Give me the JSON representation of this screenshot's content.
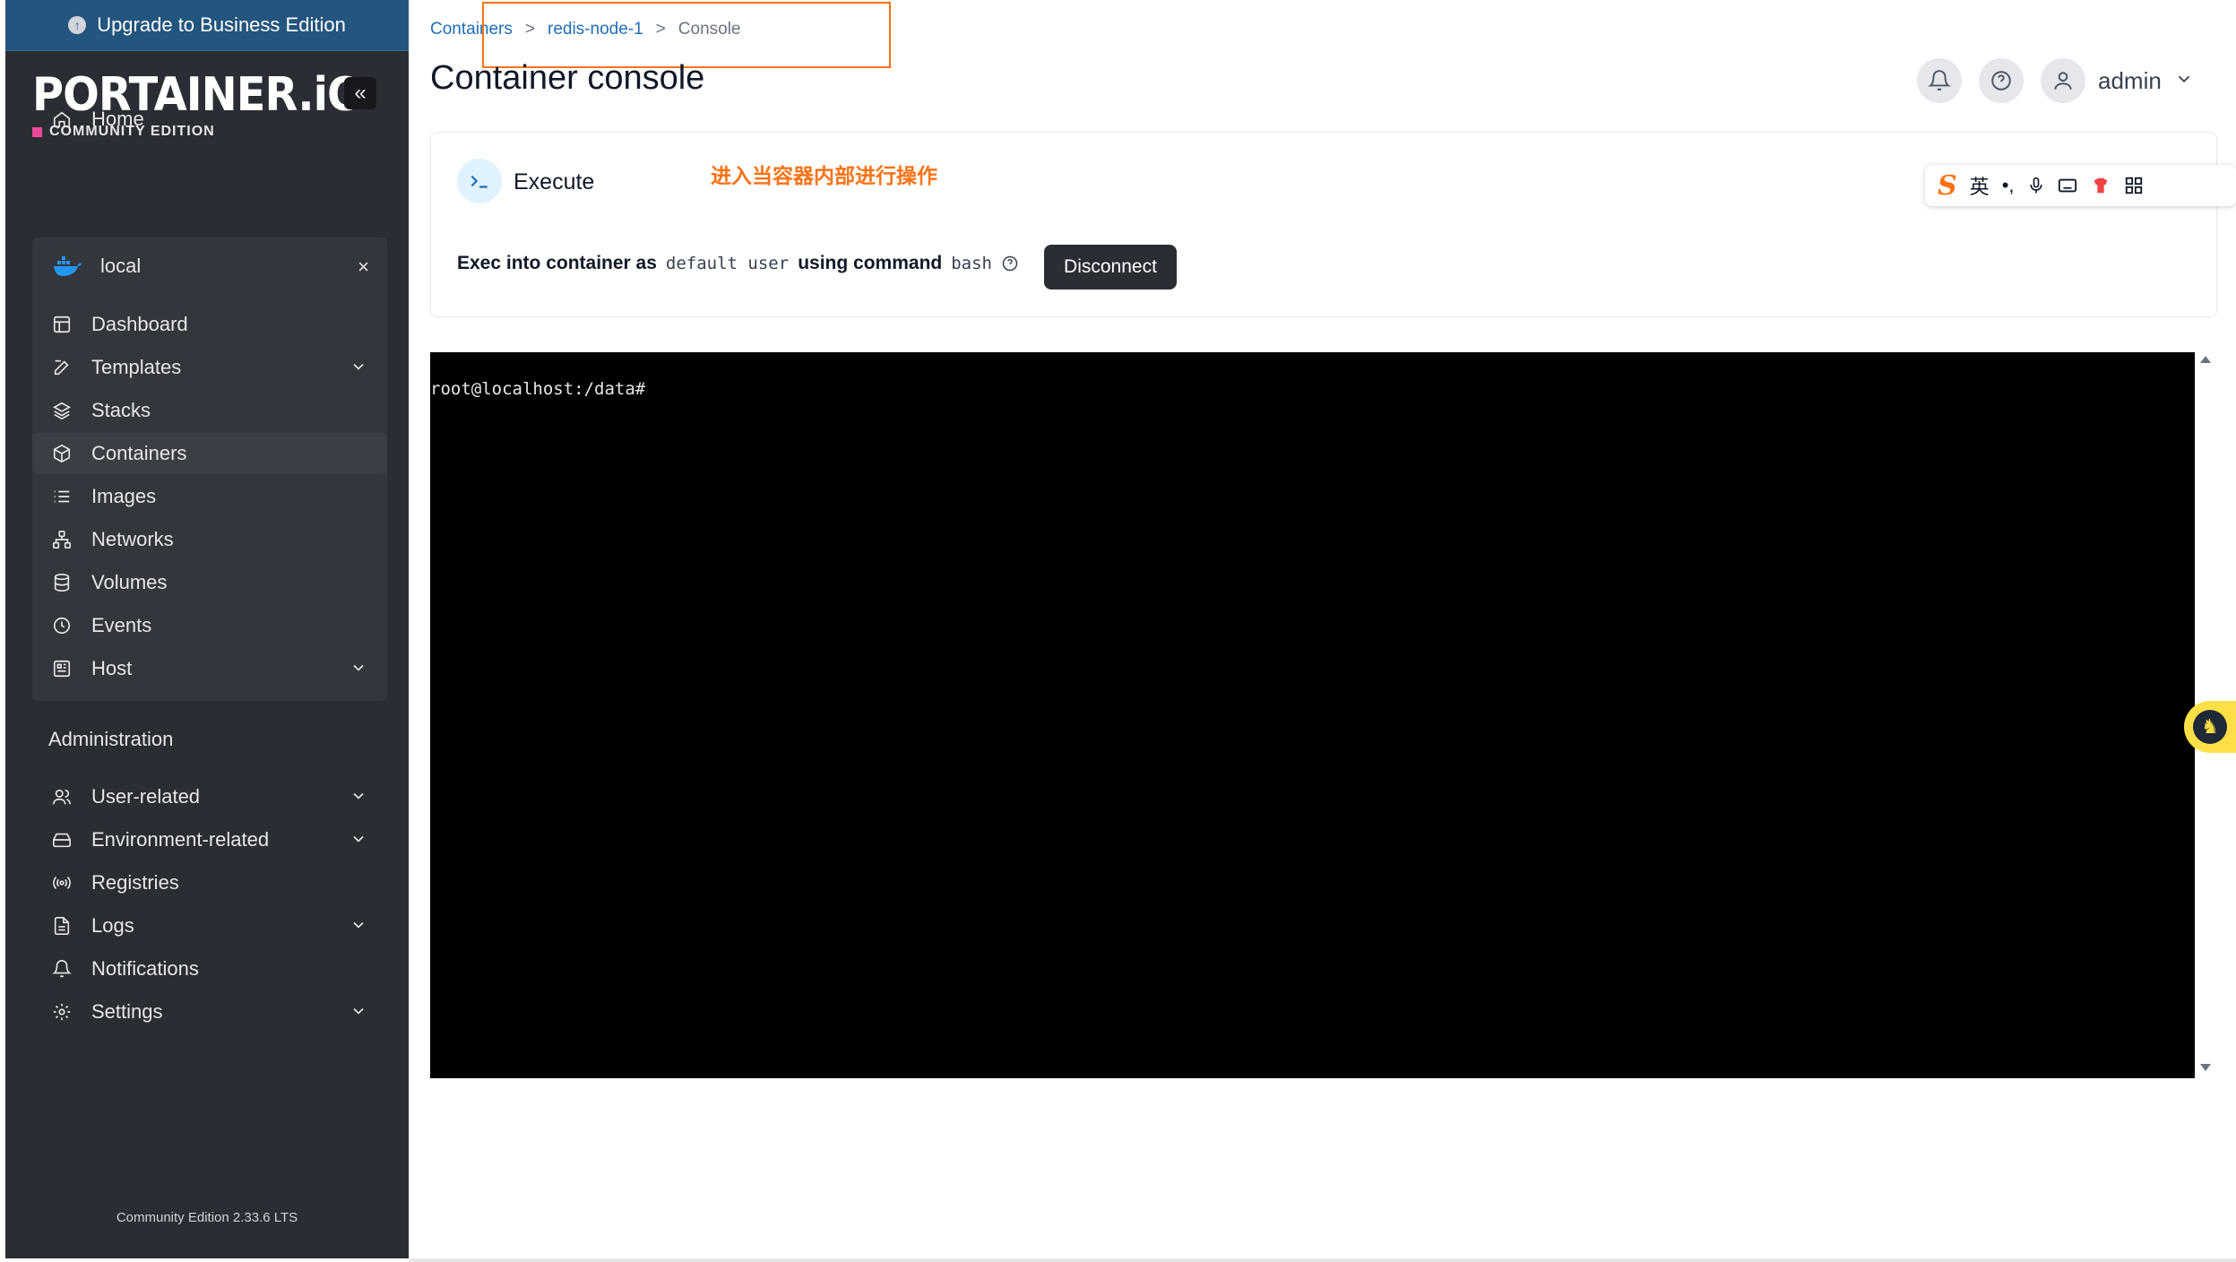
{
  "sidebar": {
    "upgrade_label": "Upgrade to Business Edition",
    "logo": "PORTAINER.iO",
    "edition": "COMMUNITY EDITION",
    "collapse_glyph": "«",
    "home": "Home",
    "environment": {
      "name": "local",
      "close_glyph": "×"
    },
    "items": [
      "Dashboard",
      "Templates",
      "Stacks",
      "Containers",
      "Images",
      "Networks",
      "Volumes",
      "Events",
      "Host"
    ],
    "active_item": "Containers",
    "admin_title": "Administration",
    "admin_items": [
      "User-related",
      "Environment-related",
      "Registries",
      "Logs",
      "Notifications",
      "Settings"
    ],
    "version": "Community Edition 2.33.6 LTS"
  },
  "breadcrumb": {
    "containers": "Containers",
    "node": "redis-node-1",
    "current": "Console",
    "sep": ">"
  },
  "page_title": "Container console",
  "user": {
    "name": "admin"
  },
  "exec": {
    "title": "Execute",
    "annotation": "进入当容器内部进行操作",
    "line_prefix": "Exec into container as",
    "user_value": "default user",
    "mid_text": "using command",
    "command": "bash",
    "disconnect_label": "Disconnect"
  },
  "ime": {
    "lang": "英"
  },
  "terminal": {
    "prompt": "root@localhost:/data#"
  },
  "colors": {
    "sidebar_bg": "#2a2d33",
    "upgrade_bg": "#23557e",
    "link": "#1d6fb8",
    "annotation": "#f97316",
    "terminal_bg": "#000000"
  }
}
